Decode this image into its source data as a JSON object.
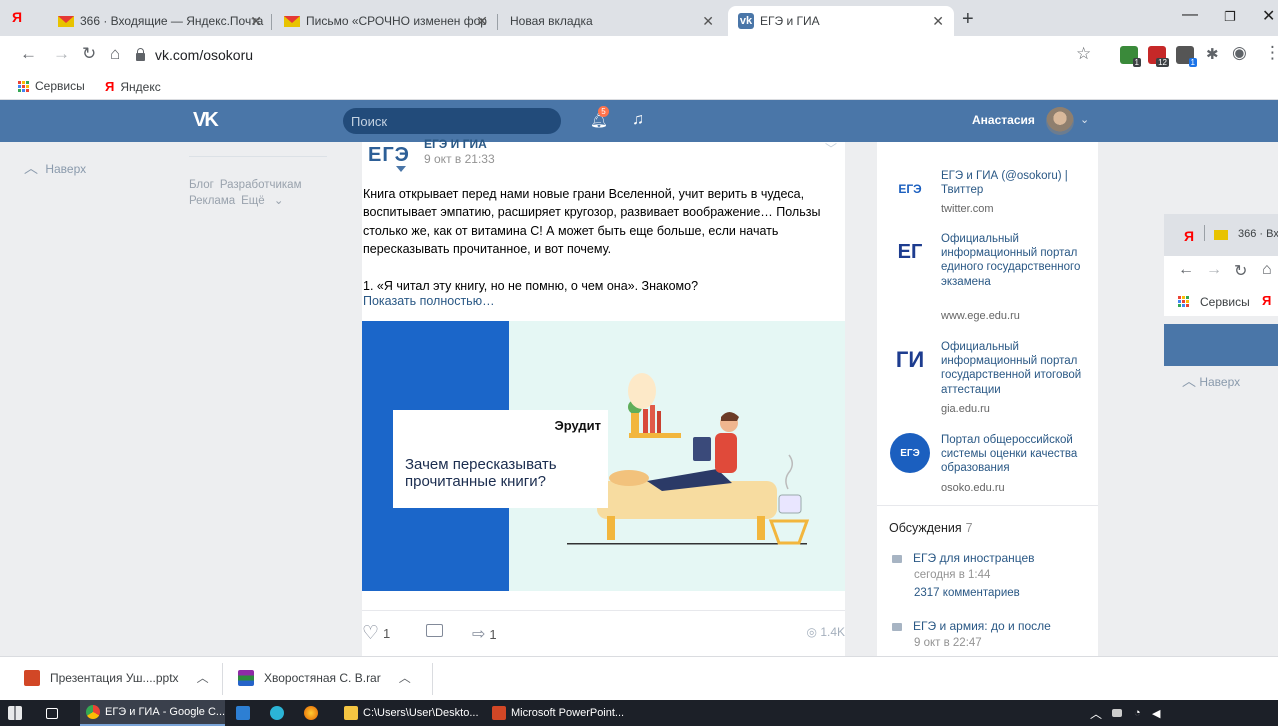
{
  "browser": {
    "tabs": [
      {
        "label": "366 · Входящие — Яндекс.Почта"
      },
      {
        "label": "Письмо «СРОЧНО изменен фор"
      },
      {
        "label": "Новая вкладка"
      },
      {
        "label": "ЕГЭ и ГИА"
      }
    ],
    "yandex_glyph": "Я",
    "vk_fav": "vk",
    "url": "vk.com/osokoru",
    "ext_badges": [
      "1",
      "12",
      "1"
    ],
    "bookmarks": [
      {
        "label": "Сервисы"
      },
      {
        "label": "Яндекс"
      }
    ]
  },
  "vk": {
    "logo": "VK",
    "search_placeholder": "Поиск",
    "notif_count": "5",
    "user_name": "Анастасия",
    "left": {
      "up_label": "Наверх",
      "links": [
        "Блог",
        "Разработчикам",
        "Реклама",
        "Ещё"
      ]
    },
    "post": {
      "group_logo": "ЕГЭ",
      "group_name": "ЕГЭ И ГИА",
      "date": "9 окт в 21:33",
      "paragraph1": "Книга открывает перед нами новые грани Вселенной, учит верить в чудеса, воспитывает эмпатию, расширяет кругозор, развивает воображение… Пользы столько же, как от витамина С! А может быть еще больше, если начать пересказывать прочитанное, и вот почему.",
      "paragraph2": "1. «Я читал эту книгу, но не помню, о чем она». Знакомо?",
      "show_more": "Показать полностью…",
      "image_brand": "Эрудит",
      "image_title": "Зачем пересказывать прочитанные книги?",
      "likes": "1",
      "shares": "1",
      "views": "1.4K"
    },
    "links": [
      {
        "title": "ЕГЭ и ГИА (@osokoru) | Твиттер",
        "domain": "twitter.com",
        "logo": "ЕГЭ"
      },
      {
        "title": "Официальный информационный портал единого государственного экзамена",
        "domain": "www.ege.edu.ru",
        "logo": "ЕГ"
      },
      {
        "title": "Официальный информационный портал государственной итоговой аттестации",
        "domain": "gia.edu.ru",
        "logo": "ГИ"
      },
      {
        "title": "Портал общероссийской системы оценки качества образования",
        "domain": "osoko.edu.ru",
        "logo": "ЕГЭ"
      }
    ],
    "discussions": {
      "label": "Обсуждения",
      "count": "7",
      "items": [
        {
          "title": "ЕГЭ для иностранцев",
          "date": "сегодня в 1:44",
          "comments": "2317 комментариев"
        },
        {
          "title": "ЕГЭ и армия: до и после",
          "date": "9 окт в 22:47"
        }
      ]
    }
  },
  "second_window": {
    "tab_label": "366 · Вх",
    "bookmark_label": "Сервисы",
    "up_label": "Наверх"
  },
  "downloads": [
    {
      "name": "Презентация Уш....pptx"
    },
    {
      "name": "Хворостяная С. В.rar"
    }
  ],
  "taskbar": [
    {
      "label": "ЕГЭ и ГИА - Google C..."
    },
    {
      "label": "C:\\Users\\User\\Deskto..."
    },
    {
      "label": "Microsoft PowerPoint..."
    }
  ],
  "colors": {
    "vk_blue": "#4a76a8",
    "link": "#2a5885",
    "image_blue": "#1b66c9"
  }
}
